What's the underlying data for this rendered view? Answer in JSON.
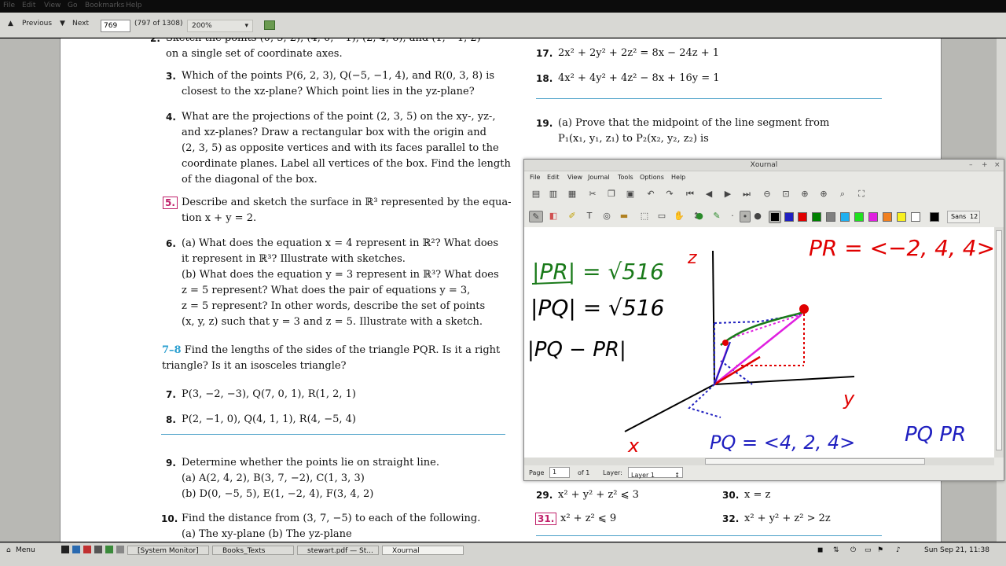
{
  "topbar": {
    "items": [
      "File",
      "Edit",
      "View",
      "Go",
      "Bookmarks",
      "Help"
    ]
  },
  "evince": {
    "prev_label": "Previous",
    "next_label": "Next",
    "page_value": "769",
    "page_of": "(797 of 1308)",
    "zoom": "200%"
  },
  "doc": {
    "left": [
      {
        "num": "2.",
        "lines": [
          "Sketch the points (0, 5, 2), (4, 0, −1), (2, 4, 6), and (1, −1, 2)",
          "on a single set of coordinate axes."
        ]
      },
      {
        "num": "3.",
        "lines": [
          "Which of the points P(6, 2, 3), Q(−5, −1, 4), and R(0, 3, 8) is",
          "closest to the xz-plane? Which point lies in the yz-plane?"
        ]
      },
      {
        "num": "4.",
        "lines": [
          "What are the projections of the point (2, 3, 5) on the xy-, yz-,",
          "and xz-planes? Draw a rectangular box with the origin and",
          "(2, 3, 5) as opposite vertices and with its faces parallel to the",
          "coordinate planes. Label all vertices of the box. Find the length",
          "of the diagonal of the box."
        ]
      },
      {
        "num": "5.",
        "lines": [
          "Describe and sketch the surface in ℝ³ represented by the equa-",
          "tion x + y = 2."
        ]
      },
      {
        "num": "6.",
        "lines": [
          "(a)  What does the equation x = 4 represent in ℝ²? What does",
          "       it represent in ℝ³? Illustrate with sketches.",
          "(b)  What does the equation y = 3 represent in ℝ³? What does",
          "       z = 5 represent? What does the pair of equations y = 3,",
          "       z = 5 represent? In other words, describe the set of points",
          "       (x, y, z) such that y = 3 and z = 5. Illustrate with a sketch."
        ]
      }
    ],
    "range_label": "7–8",
    "range_text": [
      "Find the lengths of the sides of the triangle PQR. Is it a right",
      "triangle? Is it an isosceles triangle?"
    ],
    "p7": {
      "num": "7.",
      "text": "P(3, −2, −3),    Q(7, 0, 1),    R(1, 2, 1)"
    },
    "p8": {
      "num": "8.",
      "text": "P(2, −1, 0),    Q(4, 1, 1),    R(4, −5, 4)"
    },
    "p9": {
      "num": "9.",
      "lines": [
        "Determine whether the points lie on straight line.",
        "(a)  A(2, 4, 2),    B(3, 7, −2),    C(1, 3, 3)",
        "(b)  D(0, −5, 5),    E(1, −2, 4),    F(3, 4, 2)"
      ]
    },
    "p10": {
      "num": "10.",
      "lines": [
        "Find the distance from (3, 7, −5) to each of the following.",
        "(a)  The xy-plane                              (b)  The yz-plane"
      ]
    },
    "p17": {
      "num": "17.",
      "text": "2x² + 2y² + 2z² = 8x − 24z + 1"
    },
    "p18": {
      "num": "18.",
      "text": "4x² + 4y² + 4z² − 8x + 16y = 1"
    },
    "p19": {
      "num": "19.",
      "lines": [
        "(a)  Prove that the midpoint of the line segment from",
        "       P₁(x₁, y₁, z₁) to P₂(x₂, y₂, z₂) is"
      ]
    },
    "p29": {
      "num": "29.",
      "text": "x² + y² + z² ⩽ 3"
    },
    "p30": {
      "num": "30.",
      "text": "x = z"
    },
    "p31": {
      "num": "31.",
      "text": "x² + z² ⩽ 9"
    },
    "p32": {
      "num": "32.",
      "text": "x² + y² + z² > 2z"
    }
  },
  "xournal": {
    "title": "Xournal",
    "menu": [
      "File",
      "Edit",
      "View",
      "Journal",
      "Tools",
      "Options",
      "Help"
    ],
    "font_name": "Sans",
    "font_size": "12",
    "status": {
      "page_label": "Page",
      "page_value": "1",
      "of_label": "of 1",
      "layer_label": "Layer:",
      "layer_value": "Layer 1"
    },
    "palette": [
      "#000000",
      "#2020c0",
      "#e00000",
      "#008000",
      "#808080",
      "#20b0f0",
      "#20e020",
      "#e020e0",
      "#f08020",
      "#f8f020",
      "#ffffff"
    ],
    "handwriting": {
      "pr_mag": "|PR| = √516",
      "pq_mag": "|PQ| = √516",
      "pq_minus_pr": "|PQ − PR|",
      "pr_vec": "PR = <−2, 4, 4>",
      "pq_vec": "PQ = <4, 2, 4>",
      "pq_pr": "PQ  PR",
      "axis_z": "z",
      "axis_y": "y",
      "axis_x": "x"
    }
  },
  "taskbar": {
    "menu": "Menu",
    "tasks": [
      "[System Monitor]",
      "Books_Texts",
      "stewart.pdf — St...",
      "Xournal"
    ],
    "clock": "Sun Sep 21, 11:38"
  },
  "colors": {
    "accent_cyan": "#2a9fd0",
    "accent_pink": "#c0206a",
    "ink_green": "#1a7a1a",
    "ink_red": "#e01010",
    "ink_blue": "#2020c0",
    "ink_magenta": "#e020e0"
  }
}
